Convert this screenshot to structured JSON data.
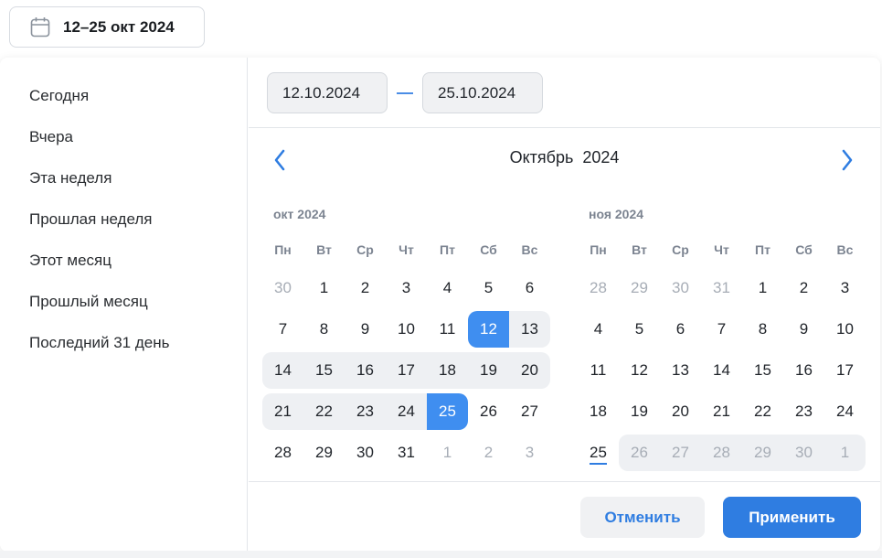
{
  "trigger": {
    "label": "12–25 окт 2024",
    "icon": "calendar-icon"
  },
  "presets": [
    "Сегодня",
    "Вчера",
    "Эта неделя",
    "Прошлая неделя",
    "Этот месяц",
    "Прошлый месяц",
    "Последний 31 день"
  ],
  "range": {
    "start": "12.10.2024",
    "end": "25.10.2024"
  },
  "header": {
    "month": "Октябрь",
    "year": "2024",
    "prev_icon": "chevron-left-icon",
    "next_icon": "chevron-right-icon"
  },
  "weekdays": [
    "Пн",
    "Вт",
    "Ср",
    "Чт",
    "Пт",
    "Сб",
    "Вс"
  ],
  "calendars": [
    {
      "caption": "окт 2024",
      "weeks": [
        [
          {
            "d": "30",
            "m": 1
          },
          {
            "d": "1"
          },
          {
            "d": "2"
          },
          {
            "d": "3"
          },
          {
            "d": "4"
          },
          {
            "d": "5"
          },
          {
            "d": "6"
          }
        ],
        [
          {
            "d": "7"
          },
          {
            "d": "8"
          },
          {
            "d": "9"
          },
          {
            "d": "10"
          },
          {
            "d": "11"
          },
          {
            "d": "12",
            "s": "sel"
          },
          {
            "d": "13",
            "r": 1
          }
        ],
        [
          {
            "d": "14",
            "r": 1
          },
          {
            "d": "15",
            "r": 1
          },
          {
            "d": "16",
            "r": 1
          },
          {
            "d": "17",
            "r": 1
          },
          {
            "d": "18",
            "r": 1
          },
          {
            "d": "19",
            "r": 1
          },
          {
            "d": "20",
            "r": 1
          }
        ],
        [
          {
            "d": "21",
            "r": 1
          },
          {
            "d": "22",
            "r": 1
          },
          {
            "d": "23",
            "r": 1
          },
          {
            "d": "24",
            "r": 1
          },
          {
            "d": "25",
            "s": "sel"
          },
          {
            "d": "26"
          },
          {
            "d": "27"
          }
        ],
        [
          {
            "d": "28"
          },
          {
            "d": "29"
          },
          {
            "d": "30"
          },
          {
            "d": "31"
          },
          {
            "d": "1",
            "m": 1
          },
          {
            "d": "2",
            "m": 1
          },
          {
            "d": "3",
            "m": 1
          }
        ]
      ]
    },
    {
      "caption": "ноя 2024",
      "weeks": [
        [
          {
            "d": "28",
            "m": 1
          },
          {
            "d": "29",
            "m": 1
          },
          {
            "d": "30",
            "m": 1
          },
          {
            "d": "31",
            "m": 1
          },
          {
            "d": "1"
          },
          {
            "d": "2"
          },
          {
            "d": "3"
          }
        ],
        [
          {
            "d": "4"
          },
          {
            "d": "5"
          },
          {
            "d": "6"
          },
          {
            "d": "7"
          },
          {
            "d": "8"
          },
          {
            "d": "9"
          },
          {
            "d": "10"
          }
        ],
        [
          {
            "d": "11"
          },
          {
            "d": "12"
          },
          {
            "d": "13"
          },
          {
            "d": "14"
          },
          {
            "d": "15"
          },
          {
            "d": "16"
          },
          {
            "d": "17"
          }
        ],
        [
          {
            "d": "18"
          },
          {
            "d": "19"
          },
          {
            "d": "20"
          },
          {
            "d": "21"
          },
          {
            "d": "22"
          },
          {
            "d": "23"
          },
          {
            "d": "24"
          }
        ],
        [
          {
            "d": "25",
            "today": 1
          },
          {
            "d": "26",
            "m": 1,
            "r": 1
          },
          {
            "d": "27",
            "m": 1,
            "r": 1
          },
          {
            "d": "28",
            "m": 1,
            "r": 1
          },
          {
            "d": "29",
            "m": 1,
            "r": 1
          },
          {
            "d": "30",
            "m": 1,
            "r": 1
          },
          {
            "d": "1",
            "m": 1,
            "r": 1
          }
        ]
      ]
    }
  ],
  "actions": {
    "cancel": "Отменить",
    "apply": "Применить"
  },
  "colors": {
    "accent": "#2f7de1",
    "selected": "#3f8ef0",
    "range_bg": "#eef0f3",
    "muted": "#a7adb6"
  }
}
